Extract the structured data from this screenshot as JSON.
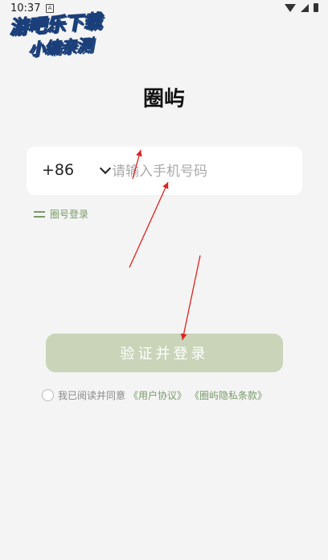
{
  "status_bar": {
    "time": "10:37",
    "notif": "A"
  },
  "watermark": {
    "line1": "游吧乐下载",
    "line2": "小编亲测"
  },
  "app_title": "圈屿",
  "phone_login": {
    "country_code": "+86",
    "placeholder": "请输入手机号码"
  },
  "switch_login": {
    "label": "圈号登录"
  },
  "login_button": {
    "label": "验证并登录"
  },
  "agreement": {
    "prefix": "我已阅读并同意",
    "user_agreement": "《用户协议》",
    "privacy_policy": "《圈屿隐私条款》"
  },
  "colors": {
    "accent": "#7a9a6a",
    "button_bg": "#c9d4b9",
    "background": "#f4f4f4",
    "annotation": "#e02020"
  }
}
